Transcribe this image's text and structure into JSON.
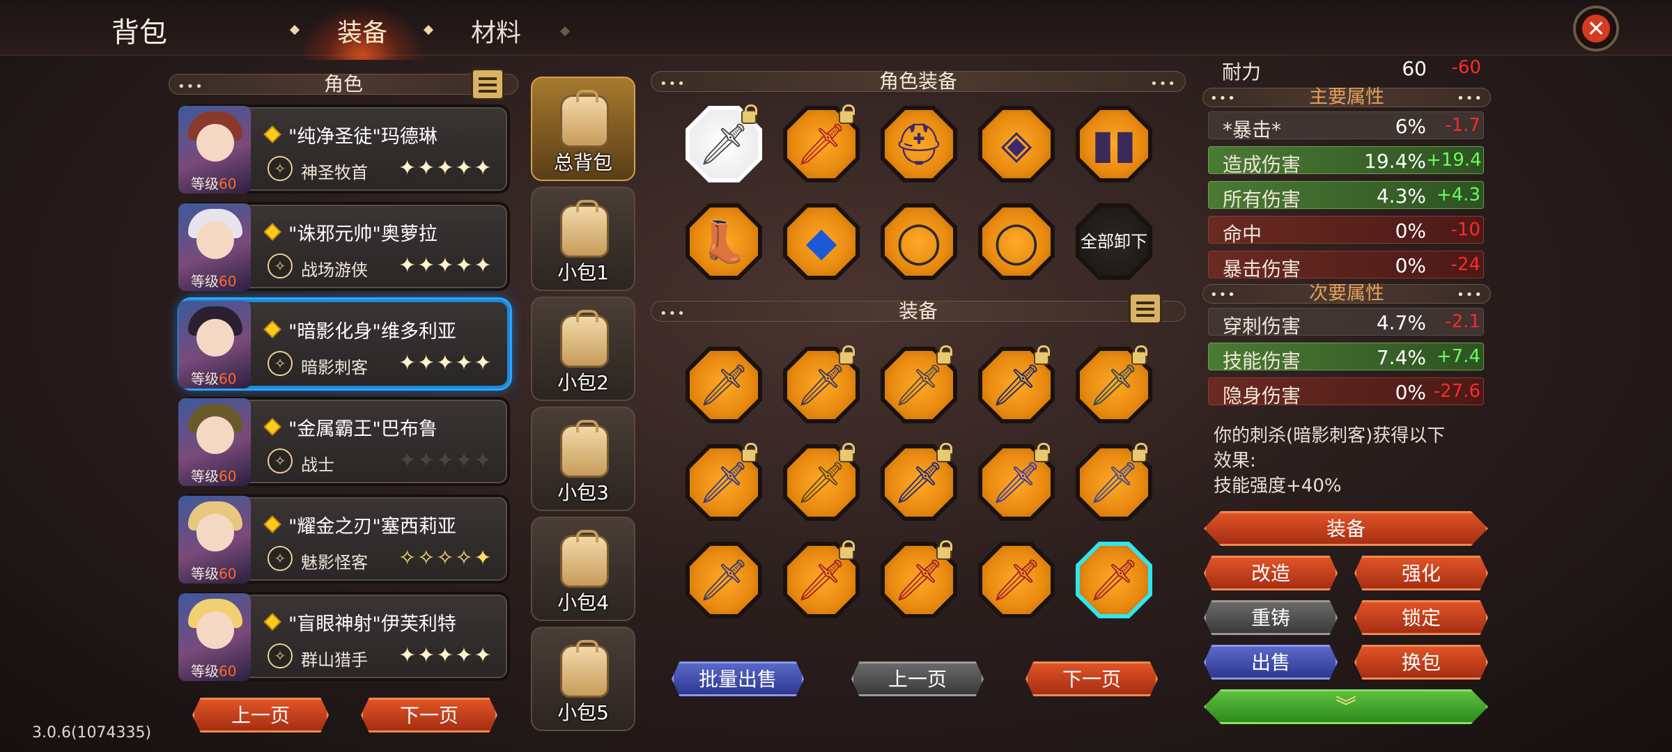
{
  "header": {
    "title": "背包",
    "tabs": [
      "装备",
      "材料"
    ]
  },
  "roles_panel": {
    "header": "角色",
    "level_label": "等级",
    "roles": [
      {
        "name": "\"纯净圣徒\"玛德琳",
        "class": "神圣牧首",
        "level": "60",
        "stars": "✦✦✦✦✦",
        "rating": 5
      },
      {
        "name": "\"诛邪元帅\"奥萝拉",
        "class": "战场游侠",
        "level": "60",
        "stars": "✦✦✦✦✦",
        "rating": 5
      },
      {
        "name": "\"暗影化身\"维多利亚",
        "class": "暗影刺客",
        "level": "60",
        "stars": "✦✦✦✦✦",
        "rating": 5,
        "selected": true
      },
      {
        "name": "\"金属霸王\"巴布鲁",
        "class": "战士",
        "level": "60",
        "stars": "✦✦✦✦✦",
        "rating": 0
      },
      {
        "name": "\"耀金之刃\"塞西莉亚",
        "class": "魅影怪客",
        "level": "60",
        "stars": "✧✧✧✧✦",
        "rating": 4
      },
      {
        "name": "\"盲眼神射\"伊芙利特",
        "class": "群山猎手",
        "level": "60",
        "stars": "✦✦✦✦✦",
        "rating": 5
      }
    ],
    "prev": "上一页",
    "next": "下一页"
  },
  "bags": [
    "总背包",
    "小包1",
    "小包2",
    "小包3",
    "小包4",
    "小包5"
  ],
  "role_equipment": {
    "header": "角色装备",
    "unequip_all": "全部卸下"
  },
  "equipment": {
    "header": "装备",
    "batch_sell": "批量出售",
    "prev": "上一页",
    "next": "下一页"
  },
  "stats": {
    "top": {
      "name": "耐力",
      "value": "60",
      "delta": "-60"
    },
    "main_header": "主要属性",
    "main": [
      {
        "name": "*暴击*",
        "value": "6%",
        "delta": "-1.7",
        "tone": "plain"
      },
      {
        "name": "造成伤害",
        "value": "19.4%",
        "delta": "+19.4",
        "tone": "green"
      },
      {
        "name": "所有伤害",
        "value": "4.3%",
        "delta": "+4.3",
        "tone": "green"
      },
      {
        "name": "命中",
        "value": "0%",
        "delta": "-10",
        "tone": "red"
      },
      {
        "name": "暴击伤害",
        "value": "0%",
        "delta": "-24",
        "tone": "red"
      }
    ],
    "sub_header": "次要属性",
    "sub": [
      {
        "name": "穿刺伤害",
        "value": "4.7%",
        "delta": "-2.1",
        "tone": "plain"
      },
      {
        "name": "技能伤害",
        "value": "7.4%",
        "delta": "+7.4",
        "tone": "green"
      },
      {
        "name": "隐身伤害",
        "value": "0%",
        "delta": "-27.6",
        "tone": "red"
      }
    ],
    "effect_lines": [
      "你的刺杀(暗影刺客)获得以下",
      "效果:",
      "技能强度+40%"
    ]
  },
  "actions": {
    "equip": "装备",
    "modify": "改造",
    "enhance": "强化",
    "recast": "重铸",
    "lock": "锁定",
    "sell": "出售",
    "switch_bag": "换包"
  },
  "version": "3.0.6(1074335)",
  "colors": {
    "accent_orange": "#e88a10",
    "selected_blue": "#2aa6ff",
    "delta_red": "#ff2a2a",
    "delta_green": "#6aff5a"
  }
}
